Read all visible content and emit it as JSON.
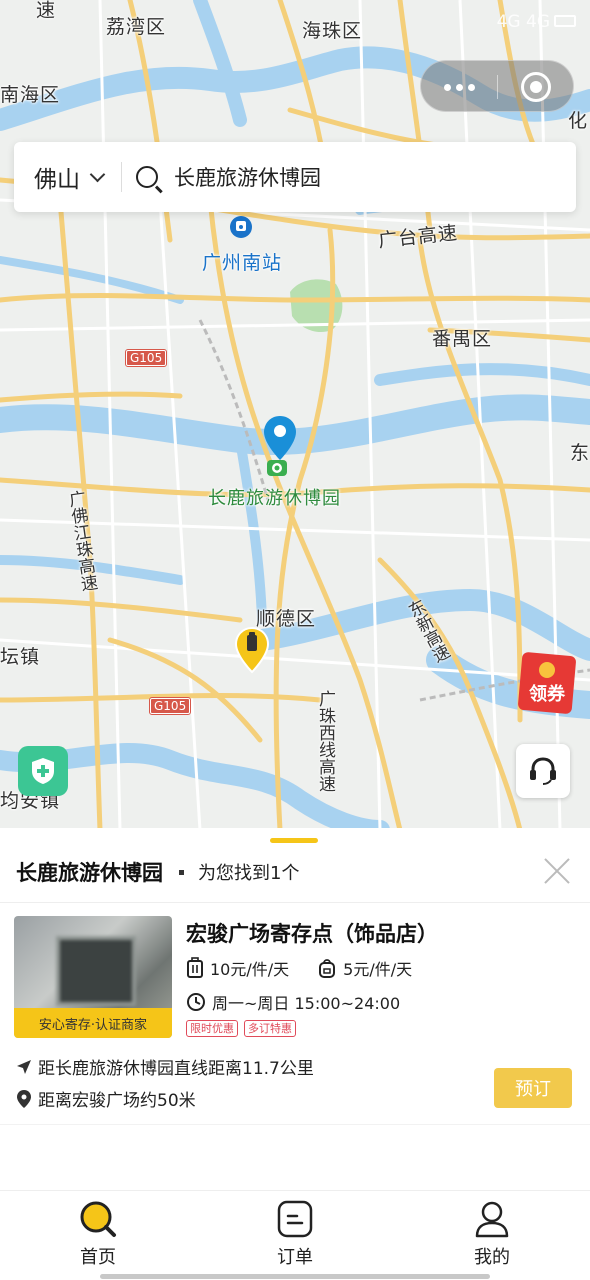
{
  "status_bar": {
    "right_text": "4G 4G"
  },
  "map": {
    "labels": {
      "liwan": "荔湾区",
      "haizhu": "海珠区",
      "nanhai": "南海区",
      "huadu_partial": "化",
      "guangzhou_south": "广州南站",
      "guangtai_expressway": "广台高速",
      "panyu": "番禺区",
      "dong_partial": "东",
      "attraction": "长鹿旅游休博园",
      "guangfo_expressway": "广佛江珠高速",
      "shunde": "顺德区",
      "dongxin_expressway": "东新高速",
      "tanzhen_partial": "坛镇",
      "guangzhu_west": "广珠西线高速",
      "junan_partial": "均安镇",
      "su_partial": "速",
      "g105_a": "G105",
      "g105_b": "G105"
    },
    "coupon_label": "领券"
  },
  "search": {
    "city": "佛山",
    "query": "长鹿旅游休博园"
  },
  "sheet": {
    "title": "长鹿旅游休博园",
    "result_text": "为您找到1个",
    "store": {
      "name": "宏骏广场寄存点（饰品店）",
      "badge": "安心寄存·认证商家",
      "price_large": "10元/件/天",
      "price_small": "5元/件/天",
      "hours": "周一~周日 15:00~24:00",
      "tags": [
        "限时优惠",
        "多订特惠"
      ],
      "distance_line": "距长鹿旅游休博园直线距离11.7公里",
      "landmark_line": "距离宏骏广场约50米",
      "book_label": "预订"
    }
  },
  "tabbar": {
    "items": [
      {
        "label": "首页",
        "icon": "search-icon"
      },
      {
        "label": "订单",
        "icon": "order-icon"
      },
      {
        "label": "我的",
        "icon": "user-icon"
      }
    ]
  },
  "colors": {
    "accent_yellow": "#f5c518",
    "pin_blue": "#1a8fd8",
    "tag_red": "#e04b5a",
    "insure_green": "#3cc694"
  }
}
